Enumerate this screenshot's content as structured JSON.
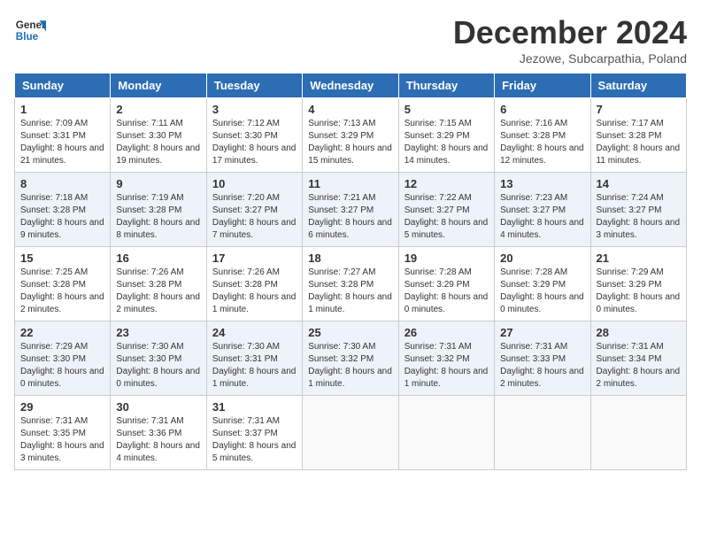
{
  "logo": {
    "line1": "General",
    "line2": "Blue"
  },
  "title": "December 2024",
  "subtitle": "Jezowe, Subcarpathia, Poland",
  "days_header": [
    "Sunday",
    "Monday",
    "Tuesday",
    "Wednesday",
    "Thursday",
    "Friday",
    "Saturday"
  ],
  "weeks": [
    [
      {
        "day": "1",
        "sunrise": "Sunrise: 7:09 AM",
        "sunset": "Sunset: 3:31 PM",
        "daylight": "Daylight: 8 hours and 21 minutes."
      },
      {
        "day": "2",
        "sunrise": "Sunrise: 7:11 AM",
        "sunset": "Sunset: 3:30 PM",
        "daylight": "Daylight: 8 hours and 19 minutes."
      },
      {
        "day": "3",
        "sunrise": "Sunrise: 7:12 AM",
        "sunset": "Sunset: 3:30 PM",
        "daylight": "Daylight: 8 hours and 17 minutes."
      },
      {
        "day": "4",
        "sunrise": "Sunrise: 7:13 AM",
        "sunset": "Sunset: 3:29 PM",
        "daylight": "Daylight: 8 hours and 15 minutes."
      },
      {
        "day": "5",
        "sunrise": "Sunrise: 7:15 AM",
        "sunset": "Sunset: 3:29 PM",
        "daylight": "Daylight: 8 hours and 14 minutes."
      },
      {
        "day": "6",
        "sunrise": "Sunrise: 7:16 AM",
        "sunset": "Sunset: 3:28 PM",
        "daylight": "Daylight: 8 hours and 12 minutes."
      },
      {
        "day": "7",
        "sunrise": "Sunrise: 7:17 AM",
        "sunset": "Sunset: 3:28 PM",
        "daylight": "Daylight: 8 hours and 11 minutes."
      }
    ],
    [
      {
        "day": "8",
        "sunrise": "Sunrise: 7:18 AM",
        "sunset": "Sunset: 3:28 PM",
        "daylight": "Daylight: 8 hours and 9 minutes."
      },
      {
        "day": "9",
        "sunrise": "Sunrise: 7:19 AM",
        "sunset": "Sunset: 3:28 PM",
        "daylight": "Daylight: 8 hours and 8 minutes."
      },
      {
        "day": "10",
        "sunrise": "Sunrise: 7:20 AM",
        "sunset": "Sunset: 3:27 PM",
        "daylight": "Daylight: 8 hours and 7 minutes."
      },
      {
        "day": "11",
        "sunrise": "Sunrise: 7:21 AM",
        "sunset": "Sunset: 3:27 PM",
        "daylight": "Daylight: 8 hours and 6 minutes."
      },
      {
        "day": "12",
        "sunrise": "Sunrise: 7:22 AM",
        "sunset": "Sunset: 3:27 PM",
        "daylight": "Daylight: 8 hours and 5 minutes."
      },
      {
        "day": "13",
        "sunrise": "Sunrise: 7:23 AM",
        "sunset": "Sunset: 3:27 PM",
        "daylight": "Daylight: 8 hours and 4 minutes."
      },
      {
        "day": "14",
        "sunrise": "Sunrise: 7:24 AM",
        "sunset": "Sunset: 3:27 PM",
        "daylight": "Daylight: 8 hours and 3 minutes."
      }
    ],
    [
      {
        "day": "15",
        "sunrise": "Sunrise: 7:25 AM",
        "sunset": "Sunset: 3:28 PM",
        "daylight": "Daylight: 8 hours and 2 minutes."
      },
      {
        "day": "16",
        "sunrise": "Sunrise: 7:26 AM",
        "sunset": "Sunset: 3:28 PM",
        "daylight": "Daylight: 8 hours and 2 minutes."
      },
      {
        "day": "17",
        "sunrise": "Sunrise: 7:26 AM",
        "sunset": "Sunset: 3:28 PM",
        "daylight": "Daylight: 8 hours and 1 minute."
      },
      {
        "day": "18",
        "sunrise": "Sunrise: 7:27 AM",
        "sunset": "Sunset: 3:28 PM",
        "daylight": "Daylight: 8 hours and 1 minute."
      },
      {
        "day": "19",
        "sunrise": "Sunrise: 7:28 AM",
        "sunset": "Sunset: 3:29 PM",
        "daylight": "Daylight: 8 hours and 0 minutes."
      },
      {
        "day": "20",
        "sunrise": "Sunrise: 7:28 AM",
        "sunset": "Sunset: 3:29 PM",
        "daylight": "Daylight: 8 hours and 0 minutes."
      },
      {
        "day": "21",
        "sunrise": "Sunrise: 7:29 AM",
        "sunset": "Sunset: 3:29 PM",
        "daylight": "Daylight: 8 hours and 0 minutes."
      }
    ],
    [
      {
        "day": "22",
        "sunrise": "Sunrise: 7:29 AM",
        "sunset": "Sunset: 3:30 PM",
        "daylight": "Daylight: 8 hours and 0 minutes."
      },
      {
        "day": "23",
        "sunrise": "Sunrise: 7:30 AM",
        "sunset": "Sunset: 3:30 PM",
        "daylight": "Daylight: 8 hours and 0 minutes."
      },
      {
        "day": "24",
        "sunrise": "Sunrise: 7:30 AM",
        "sunset": "Sunset: 3:31 PM",
        "daylight": "Daylight: 8 hours and 1 minute."
      },
      {
        "day": "25",
        "sunrise": "Sunrise: 7:30 AM",
        "sunset": "Sunset: 3:32 PM",
        "daylight": "Daylight: 8 hours and 1 minute."
      },
      {
        "day": "26",
        "sunrise": "Sunrise: 7:31 AM",
        "sunset": "Sunset: 3:32 PM",
        "daylight": "Daylight: 8 hours and 1 minute."
      },
      {
        "day": "27",
        "sunrise": "Sunrise: 7:31 AM",
        "sunset": "Sunset: 3:33 PM",
        "daylight": "Daylight: 8 hours and 2 minutes."
      },
      {
        "day": "28",
        "sunrise": "Sunrise: 7:31 AM",
        "sunset": "Sunset: 3:34 PM",
        "daylight": "Daylight: 8 hours and 2 minutes."
      }
    ],
    [
      {
        "day": "29",
        "sunrise": "Sunrise: 7:31 AM",
        "sunset": "Sunset: 3:35 PM",
        "daylight": "Daylight: 8 hours and 3 minutes."
      },
      {
        "day": "30",
        "sunrise": "Sunrise: 7:31 AM",
        "sunset": "Sunset: 3:36 PM",
        "daylight": "Daylight: 8 hours and 4 minutes."
      },
      {
        "day": "31",
        "sunrise": "Sunrise: 7:31 AM",
        "sunset": "Sunset: 3:37 PM",
        "daylight": "Daylight: 8 hours and 5 minutes."
      },
      null,
      null,
      null,
      null
    ]
  ]
}
